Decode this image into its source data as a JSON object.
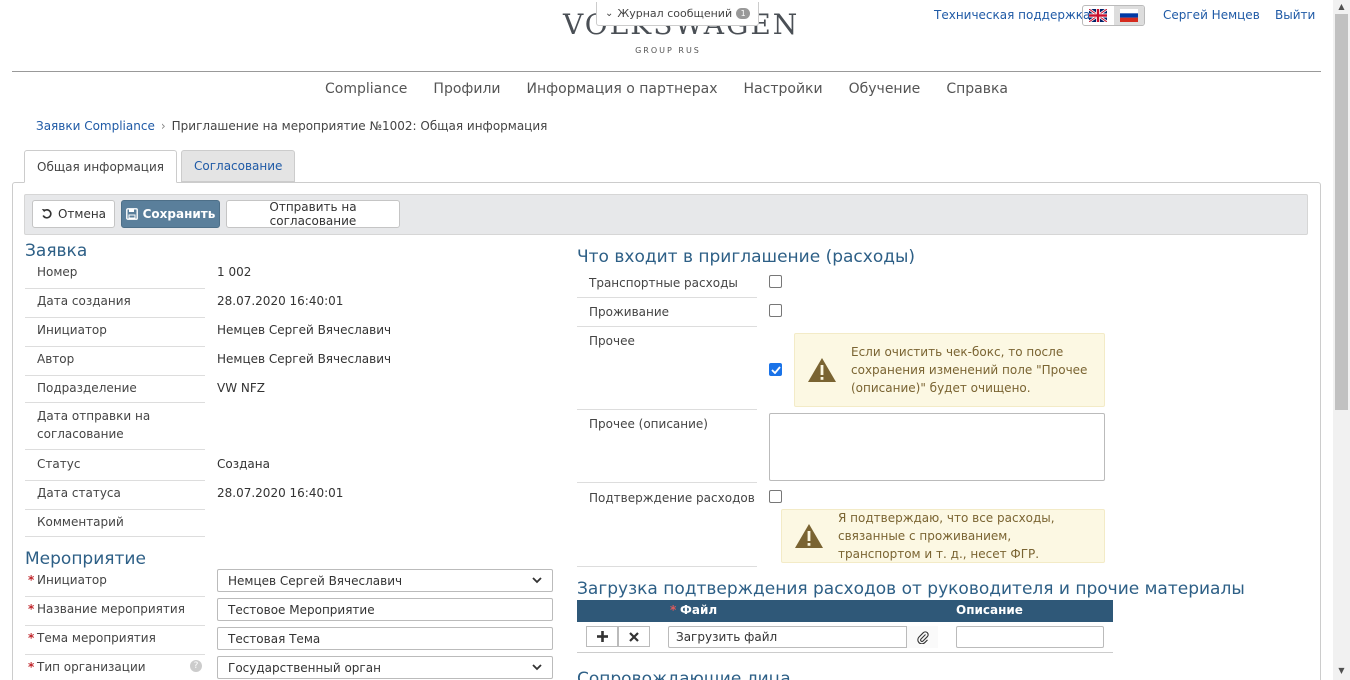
{
  "header": {
    "logo_main": "VOLKSWAGEN",
    "logo_sub": "GROUP RUS",
    "journal_label": "Журнал сообщений",
    "journal_count": "1",
    "support_link": "Техническая поддержка",
    "user_name": "Сергей Немцев",
    "logout": "Выйти"
  },
  "nav": [
    "Compliance",
    "Профили",
    "Информация о партнерах",
    "Настройки",
    "Обучение",
    "Справка"
  ],
  "breadcrumb": {
    "root": "Заявки Compliance",
    "current": "Приглашение на мероприятие №1002: Общая информация"
  },
  "tabs": [
    "Общая информация",
    "Согласование"
  ],
  "toolbar": {
    "cancel": "Отмена",
    "save": "Сохранить",
    "send": "Отправить на согласование"
  },
  "application": {
    "title": "Заявка",
    "rows": [
      {
        "label": "Номер",
        "value": "1 002"
      },
      {
        "label": "Дата создания",
        "value": "28.07.2020 16:40:01"
      },
      {
        "label": "Инициатор",
        "value": "Немцев Сергей Вячеславич"
      },
      {
        "label": "Автор",
        "value": "Немцев Сергей Вячеславич"
      },
      {
        "label": "Подразделение",
        "value": "VW NFZ"
      },
      {
        "label": "Дата отправки на согласование",
        "value": ""
      },
      {
        "label": "Статус",
        "value": "Создана"
      },
      {
        "label": "Дата статуса",
        "value": "28.07.2020 16:40:01"
      },
      {
        "label": "Комментарий",
        "value": ""
      }
    ]
  },
  "event": {
    "title": "Мероприятие",
    "rows": [
      {
        "label": "Инициатор",
        "value": "Немцев Сергей Вячеславич",
        "kind": "select"
      },
      {
        "label": "Название мероприятия",
        "value": "Тестовое Мероприятие",
        "kind": "input"
      },
      {
        "label": "Тема мероприятия",
        "value": "Тестовая Тема",
        "kind": "input"
      },
      {
        "label": "Тип организации",
        "value": "Государственный орган",
        "kind": "select"
      }
    ],
    "required_mark": "*",
    "help_mark": "?"
  },
  "expenses": {
    "title": "Что входит в приглашение (расходы)",
    "rows": [
      {
        "label": "Транспортные расходы",
        "checked": false
      },
      {
        "label": "Проживание",
        "checked": false
      },
      {
        "label": "Прочее",
        "checked": true
      },
      {
        "label": "Прочее (описание)",
        "checked": null
      },
      {
        "label": "Подтверждение расходов",
        "checked": false
      }
    ],
    "warning_other": "Если очистить чек-бокс, то после сохранения изменений поле \"Прочее (описание)\" будет очищено.",
    "warning_confirm": "Я подтверждаю, что все расходы, связанные с проживанием, транспортом и т. д., несет ФГР."
  },
  "files": {
    "title": "Загрузка подтверждения расходов от руководителя и прочие материалы",
    "col_file": "Файл",
    "col_desc": "Описание",
    "upload_label": "Загрузить файл"
  },
  "next_section": "Сопровождающие лица",
  "colors": {
    "accent": "#2d5f86",
    "primary_button": "#5a7f9b",
    "table_header": "#2f5878",
    "warning_bg": "#fcf8e3",
    "link": "#1f5aa6",
    "required": "#c0282d"
  }
}
